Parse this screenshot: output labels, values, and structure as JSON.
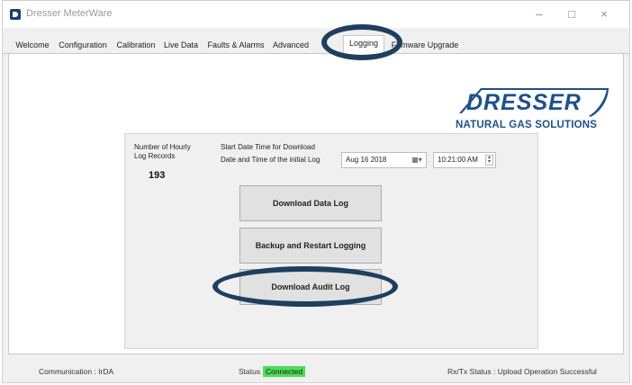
{
  "window": {
    "title": "Dresser MeterWare",
    "controls": [
      "–",
      "□",
      "×"
    ]
  },
  "tabs": [
    {
      "label": "Welcome"
    },
    {
      "label": "Configuration"
    },
    {
      "label": "Calibration"
    },
    {
      "label": "Live Data"
    },
    {
      "label": "Faults & Alarms"
    },
    {
      "label": "Advanced"
    },
    {
      "label": "Logging"
    },
    {
      "label": "Firmware Upgrade"
    }
  ],
  "active_tab": "Logging",
  "logo": {
    "wordmark": "DRESSER",
    "tagline": "NATURAL GAS SOLUTIONS",
    "color": "#1d4f91"
  },
  "logging": {
    "records_label_line1": "Number of Hourly",
    "records_label_line2": "Log Records",
    "records_count": "193",
    "start_label": "Start Date Time for Download",
    "initial_label": "Date and Time of the initial Log",
    "date_value": "Aug 16 2018",
    "time_value": "10:21:00 AM",
    "calendar_icon": "calendar-icon",
    "buttons": {
      "download_data": "Download Data Log",
      "backup_restart": "Backup and Restart Logging",
      "download_audit": "Download Audit Log"
    }
  },
  "status": {
    "communication": "Communication : IrDA",
    "status_label": "Status",
    "status_value": "Connected",
    "status_color": "#4dde55",
    "rxtx": "Rx/Tx Status : Upload Operation Successful"
  },
  "annotation_color": "#1f3f5f"
}
